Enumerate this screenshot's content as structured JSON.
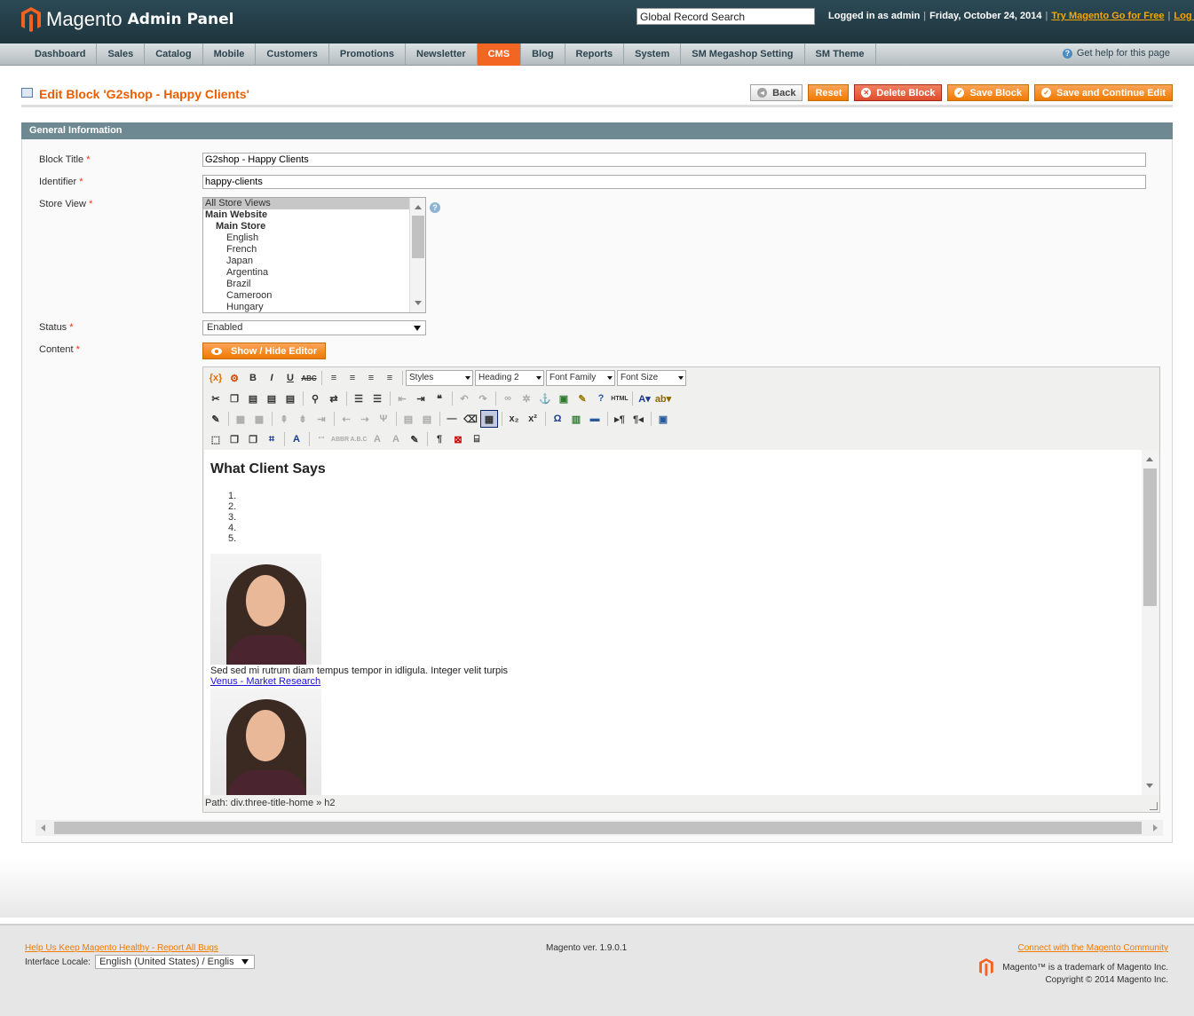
{
  "header": {
    "logo_text": "Magento",
    "logo_sub": "Admin Panel",
    "search_value": "Global Record Search",
    "logged_in": "Logged in as admin",
    "date": "Friday, October 24, 2014",
    "try_link": "Try Magento Go for Free",
    "logout": "Log Out"
  },
  "nav": {
    "items": [
      "Dashboard",
      "Sales",
      "Catalog",
      "Mobile",
      "Customers",
      "Promotions",
      "Newsletter",
      "CMS",
      "Blog",
      "Reports",
      "System",
      "SM Megashop Setting",
      "SM Theme"
    ],
    "active": "CMS",
    "help": "Get help for this page"
  },
  "page": {
    "title": "Edit Block 'G2shop - Happy Clients'",
    "buttons": {
      "back": "Back",
      "reset": "Reset",
      "delete": "Delete Block",
      "save": "Save Block",
      "save_continue": "Save and Continue Edit"
    }
  },
  "form": {
    "section": "General Information",
    "block_title_label": "Block Title",
    "block_title_value": "G2shop - Happy Clients",
    "identifier_label": "Identifier",
    "identifier_value": "happy-clients",
    "store_view_label": "Store View",
    "store_options": [
      "All Store Views",
      "Main Website",
      "Main Store",
      "English",
      "French",
      "Japan",
      "Argentina",
      "Brazil",
      "Cameroon",
      "Hungary"
    ],
    "status_label": "Status",
    "status_value": "Enabled",
    "content_label": "Content",
    "show_hide": "Show / Hide Editor",
    "required_mark": "*"
  },
  "editor": {
    "styles": "Styles",
    "format": "Heading 2",
    "font_family": "Font Family",
    "font_size": "Font Size",
    "heading": "What Client Says",
    "quote": "Sed sed mi rutrum diam tempus tempor in idligula. Integer velit turpis",
    "author_link": "Venus - Market Research",
    "path": "Path: div.three-title-home » h2"
  },
  "footer": {
    "report_bugs": "Help Us Keep Magento Healthy - Report All Bugs",
    "version": "Magento ver. 1.9.0.1",
    "community": "Connect with the Magento Community",
    "locale_label": "Interface Locale:",
    "locale_value": "English (United States) / Englis",
    "trademark": "Magento™ is a trademark of Magento Inc.",
    "copyright": "Copyright © 2014 Magento Inc."
  },
  "colors": {
    "brand_orange": "#f07a00",
    "title_orange": "#eb5e00",
    "header_bg": "#1e343d",
    "section_bg": "#6f8992"
  }
}
